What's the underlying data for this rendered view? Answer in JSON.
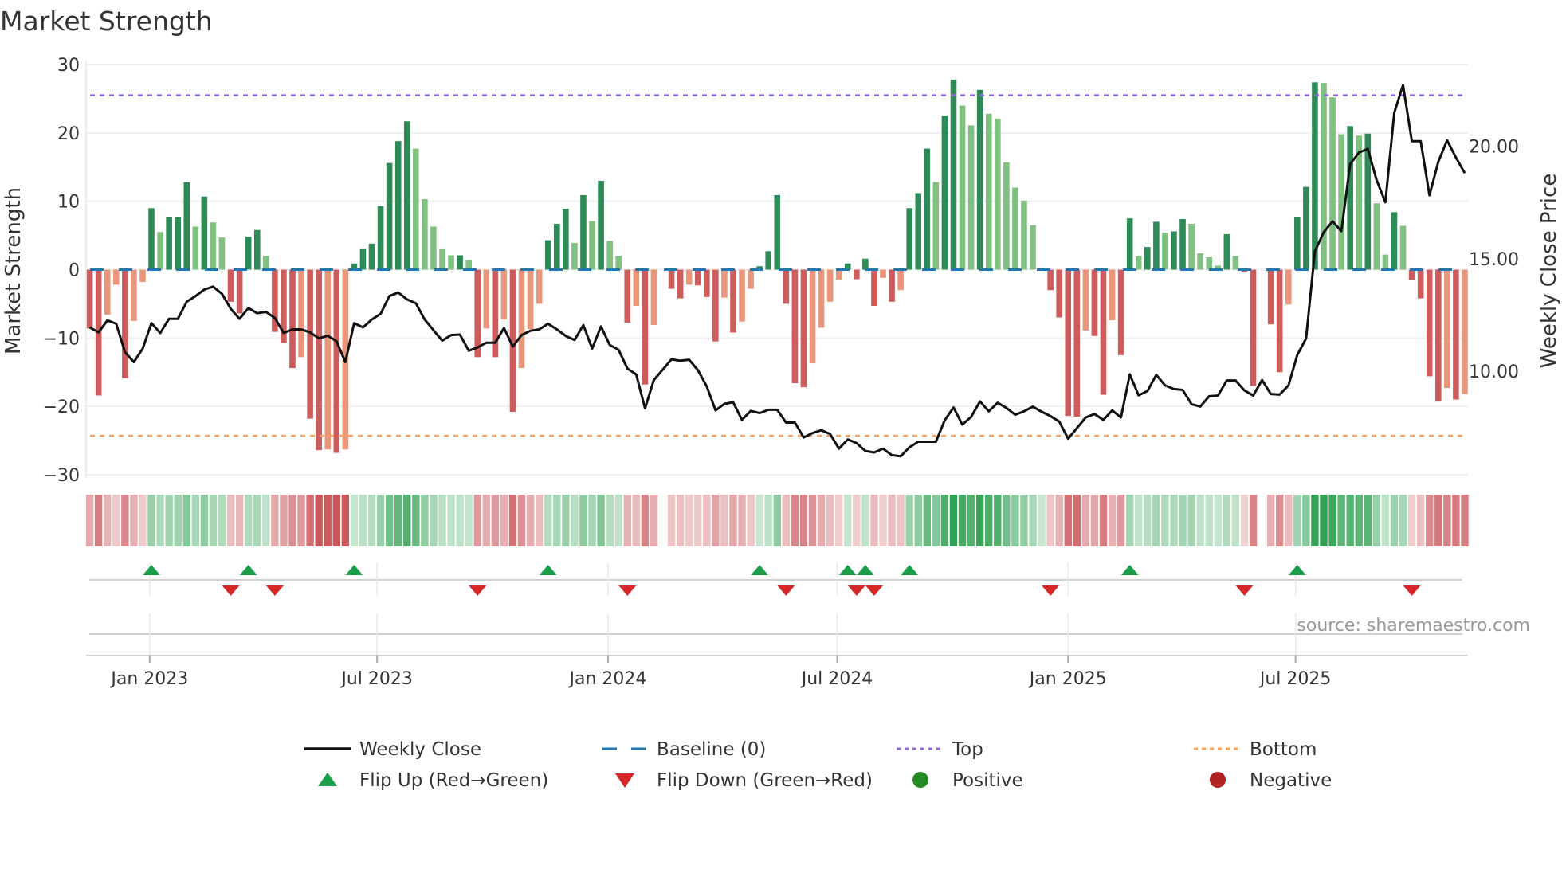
{
  "chart_data": {
    "type": "bar",
    "title": "Market Strength",
    "ylabel": "Market Strength",
    "y2label": "Weekly Close Price",
    "ylim": [
      -30,
      30
    ],
    "y2lim": [
      5.4,
      23.63
    ],
    "yticks": [
      30,
      20,
      10,
      0,
      -10,
      -20,
      -30
    ],
    "ytick_labels": [
      "30",
      "20",
      "10",
      "0",
      "−10",
      "−20",
      "−30"
    ],
    "y2ticks": [
      20,
      15,
      10
    ],
    "y2tick_labels": [
      "20.00",
      "15.00",
      "10.00"
    ],
    "top_level": 25.5,
    "bottom_level": -24.3,
    "x_ticks": [
      {
        "label": "Jan 2023",
        "week_index": 6.8
      },
      {
        "label": "Jul 2023",
        "week_index": 32.6
      },
      {
        "label": "Jan 2024",
        "week_index": 58.8
      },
      {
        "label": "Jul 2024",
        "week_index": 84.8
      },
      {
        "label": "Jan 2025",
        "week_index": 111.0
      },
      {
        "label": "Jul 2025",
        "week_index": 136.8
      }
    ],
    "strength": [
      -8.6,
      -18.4,
      -6.6,
      -2.2,
      -15.9,
      -7.5,
      -1.8,
      9,
      5.5,
      7.7,
      7.7,
      12.8,
      6.3,
      10.7,
      6.9,
      4.7,
      -4.7,
      -6.4,
      4.8,
      5.8,
      2,
      -9.1,
      -10.7,
      -14.4,
      -12.8,
      -21.8,
      -26.4,
      -26.3,
      -26.8,
      -26.3,
      0.9,
      3.1,
      3.8,
      9.3,
      15.6,
      18.8,
      21.7,
      17.7,
      10.3,
      6.3,
      3.1,
      2.1,
      2.1,
      1.4,
      -12.8,
      -8.6,
      -12.8,
      -7.3,
      -20.8,
      -14.4,
      -8.7,
      -5,
      4.3,
      6.7,
      8.9,
      3.9,
      10.9,
      7.1,
      13,
      4.2,
      2,
      -7.75,
      -5.3,
      -16.8,
      -8.1,
      0,
      -2.8,
      -4.2,
      -2.2,
      -2.3,
      -4,
      -10.5,
      -4.1,
      -9.2,
      -7.6,
      -2.8,
      0.5,
      2.7,
      10.9,
      -5,
      -16.6,
      -17.2,
      -13.7,
      -8.5,
      -4.7,
      -1.5,
      0.9,
      -1.4,
      1.6,
      -5.3,
      -1.2,
      -4.7,
      -3,
      9,
      11.2,
      17.7,
      12.8,
      22.5,
      27.8,
      24,
      21.1,
      26.3,
      22.8,
      22.1,
      15.7,
      12,
      10.1,
      6.5,
      0.3,
      -3,
      -7,
      -21.4,
      -21.5,
      -8.9,
      -9.7,
      -18.3,
      -7.4,
      -12.5,
      7.5,
      2,
      3.3,
      7,
      5.4,
      5.6,
      7.4,
      6.7,
      2.4,
      1.8,
      0.6,
      5.2,
      2,
      -0.4,
      -17,
      0,
      -8,
      -15,
      -5.1,
      7.75,
      12.1,
      27.4,
      27.3,
      25.2,
      19.8,
      21,
      19.6,
      19.9,
      9.7,
      2.2,
      8.4,
      6.4,
      -1.5,
      -4.2,
      -15.6,
      -19.3,
      -17.3,
      -19,
      -18.2
    ],
    "weekly_close": [
      11.95,
      11.73,
      12.26,
      12.11,
      10.85,
      10.41,
      11.0,
      12.14,
      11.7,
      12.33,
      12.33,
      13.09,
      13.34,
      13.63,
      13.76,
      13.44,
      12.77,
      12.33,
      12.81,
      12.58,
      12.64,
      12.37,
      11.7,
      11.86,
      11.86,
      11.73,
      11.46,
      11.58,
      11.33,
      10.41,
      12.14,
      11.95,
      12.3,
      12.55,
      13.34,
      13.5,
      13.19,
      13.02,
      12.3,
      11.82,
      11.36,
      11.61,
      11.63,
      10.91,
      11.06,
      11.27,
      11.27,
      11.92,
      11.1,
      11.61,
      11.8,
      11.86,
      12.11,
      11.86,
      11.57,
      11.39,
      12.05,
      11.01,
      11.99,
      11.17,
      10.95,
      10.12,
      9.86,
      8.35,
      9.61,
      10.07,
      10.53,
      10.47,
      10.51,
      10.05,
      9.33,
      8.26,
      8.55,
      8.62,
      7.84,
      8.24,
      8.14,
      8.29,
      8.29,
      7.72,
      7.72,
      7.06,
      7.25,
      7.38,
      7.21,
      6.56,
      6.97,
      6.81,
      6.46,
      6.39,
      6.56,
      6.27,
      6.22,
      6.62,
      6.87,
      6.87,
      6.87,
      7.82,
      8.39,
      7.63,
      7.97,
      8.66,
      8.22,
      8.6,
      8.37,
      8.07,
      8.22,
      8.43,
      8.2,
      8.01,
      7.76,
      7.0,
      7.47,
      7.95,
      8.1,
      7.84,
      8.26,
      7.95,
      9.86,
      8.93,
      9.12,
      9.84,
      9.37,
      9.21,
      9.17,
      8.54,
      8.43,
      8.89,
      8.92,
      9.59,
      9.59,
      9.15,
      8.92,
      9.61,
      8.99,
      8.96,
      9.37,
      10.72,
      11.46,
      15.33,
      16.18,
      16.66,
      16.22,
      19.21,
      19.72,
      19.88,
      18.49,
      17.51,
      21.48,
      22.72,
      20.22,
      20.22,
      17.82,
      19.31,
      20.26,
      19.5,
      18.81
    ],
    "flip_up_indices": [
      7,
      18,
      30,
      52,
      76,
      86,
      88,
      93,
      118,
      137
    ],
    "flip_down_indices": [
      16,
      21,
      44,
      61,
      79,
      87,
      89,
      109,
      131,
      150
    ],
    "legend": [
      {
        "label": "Weekly Close",
        "marker": "line"
      },
      {
        "label": "Baseline (0)",
        "marker": "dashed"
      },
      {
        "label": "Top",
        "marker": "dotted"
      },
      {
        "label": "Bottom",
        "marker": "dotted"
      },
      {
        "label": "Flip Up (Red→Green)",
        "marker": "triangle-up"
      },
      {
        "label": "Flip Down (Green→Red)",
        "marker": "triangle-down"
      },
      {
        "label": "Positive",
        "marker": "circle"
      },
      {
        "label": "Negative",
        "marker": "circle"
      }
    ],
    "legend_placement": "bottom",
    "grid": true
  },
  "source": "source: sharemaestro.com",
  "colors": {
    "pos_strong": "#2e8b57",
    "pos_weak": "#80c080",
    "neg_strong": "#cd5c5c",
    "neg_weak": "#e9967a",
    "line": "#111111",
    "baseline": "#1f77b4",
    "top": "#9467dd",
    "bottom": "#f4a460",
    "flip_up": "#1a9e4a",
    "flip_down": "#d62728",
    "positive": "#228b22",
    "negative": "#b22222"
  }
}
